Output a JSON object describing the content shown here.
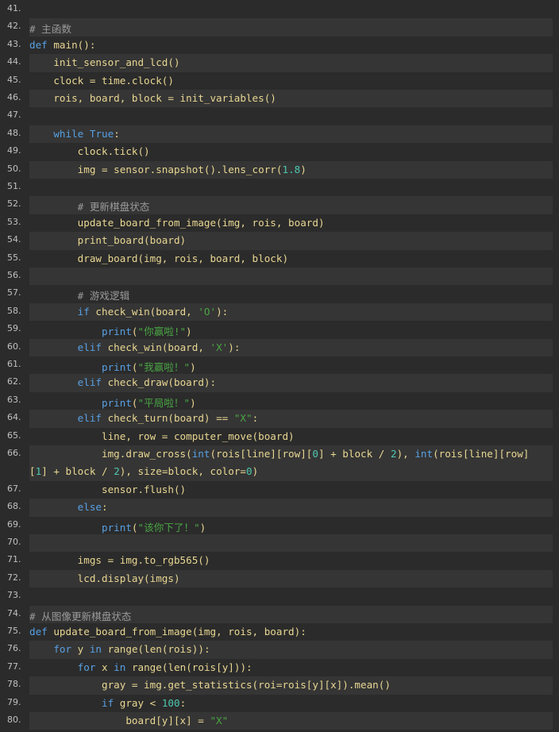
{
  "colors": {
    "background": "#2b2b2b",
    "alt_row": "#353535",
    "keyword": "#57a0e3",
    "function": "#e9d792",
    "string": "#4aa544",
    "number": "#4ec9b0",
    "comment": "#9a9a9a",
    "text": "#d0d0d0",
    "line_number": "#c0c0c0"
  },
  "lines": [
    {
      "num": "41.",
      "tokens": []
    },
    {
      "num": "42.",
      "tokens": [
        {
          "t": "# 主函数",
          "c": "comment"
        }
      ]
    },
    {
      "num": "43.",
      "tokens": [
        {
          "t": "def",
          "c": "kw"
        },
        {
          "t": " main():",
          "c": "fn"
        }
      ]
    },
    {
      "num": "44.",
      "tokens": [
        {
          "t": "    init_sensor_and_lcd()",
          "c": "fn"
        }
      ]
    },
    {
      "num": "45.",
      "tokens": [
        {
          "t": "    clock = time.clock()",
          "c": "fn"
        }
      ]
    },
    {
      "num": "46.",
      "tokens": [
        {
          "t": "    rois, board, block = init_variables()",
          "c": "fn"
        }
      ]
    },
    {
      "num": "47.",
      "tokens": []
    },
    {
      "num": "48.",
      "tokens": [
        {
          "t": "    ",
          "c": "default"
        },
        {
          "t": "while",
          "c": "kw"
        },
        {
          "t": " ",
          "c": "default"
        },
        {
          "t": "True",
          "c": "kw"
        },
        {
          "t": ":",
          "c": "fn"
        }
      ]
    },
    {
      "num": "49.",
      "tokens": [
        {
          "t": "        clock.tick()",
          "c": "fn"
        }
      ]
    },
    {
      "num": "50.",
      "tokens": [
        {
          "t": "        img = sensor.snapshot().lens_corr(",
          "c": "fn"
        },
        {
          "t": "1.8",
          "c": "num"
        },
        {
          "t": ")",
          "c": "fn"
        }
      ]
    },
    {
      "num": "51.",
      "tokens": []
    },
    {
      "num": "52.",
      "tokens": [
        {
          "t": "        # 更新棋盘状态",
          "c": "comment"
        }
      ]
    },
    {
      "num": "53.",
      "tokens": [
        {
          "t": "        update_board_from_image(img, rois, board)",
          "c": "fn"
        }
      ]
    },
    {
      "num": "54.",
      "tokens": [
        {
          "t": "        print_board(board)",
          "c": "fn"
        }
      ]
    },
    {
      "num": "55.",
      "tokens": [
        {
          "t": "        draw_board(img, rois, board, block)",
          "c": "fn"
        }
      ]
    },
    {
      "num": "56.",
      "tokens": []
    },
    {
      "num": "57.",
      "tokens": [
        {
          "t": "        # 游戏逻辑",
          "c": "comment"
        }
      ]
    },
    {
      "num": "58.",
      "tokens": [
        {
          "t": "        ",
          "c": "default"
        },
        {
          "t": "if",
          "c": "kw"
        },
        {
          "t": " check_win(board, ",
          "c": "fn"
        },
        {
          "t": "'O'",
          "c": "str"
        },
        {
          "t": "):",
          "c": "fn"
        }
      ]
    },
    {
      "num": "59.",
      "tokens": [
        {
          "t": "            ",
          "c": "default"
        },
        {
          "t": "print",
          "c": "kw"
        },
        {
          "t": "(",
          "c": "fn"
        },
        {
          "t": "\"你赢啦!\"",
          "c": "str"
        },
        {
          "t": ")",
          "c": "fn"
        }
      ]
    },
    {
      "num": "60.",
      "tokens": [
        {
          "t": "        ",
          "c": "default"
        },
        {
          "t": "elif",
          "c": "kw"
        },
        {
          "t": " check_win(board, ",
          "c": "fn"
        },
        {
          "t": "'X'",
          "c": "str"
        },
        {
          "t": "):",
          "c": "fn"
        }
      ]
    },
    {
      "num": "61.",
      "tokens": [
        {
          "t": "            ",
          "c": "default"
        },
        {
          "t": "print",
          "c": "kw"
        },
        {
          "t": "(",
          "c": "fn"
        },
        {
          "t": "\"我赢啦！\"",
          "c": "str"
        },
        {
          "t": ")",
          "c": "fn"
        }
      ]
    },
    {
      "num": "62.",
      "tokens": [
        {
          "t": "        ",
          "c": "default"
        },
        {
          "t": "elif",
          "c": "kw"
        },
        {
          "t": " check_draw(board):",
          "c": "fn"
        }
      ]
    },
    {
      "num": "63.",
      "tokens": [
        {
          "t": "            ",
          "c": "default"
        },
        {
          "t": "print",
          "c": "kw"
        },
        {
          "t": "(",
          "c": "fn"
        },
        {
          "t": "\"平局啦！\"",
          "c": "str"
        },
        {
          "t": ")",
          "c": "fn"
        }
      ]
    },
    {
      "num": "64.",
      "tokens": [
        {
          "t": "        ",
          "c": "default"
        },
        {
          "t": "elif",
          "c": "kw"
        },
        {
          "t": " check_turn(board) == ",
          "c": "fn"
        },
        {
          "t": "\"X\"",
          "c": "str"
        },
        {
          "t": ":",
          "c": "fn"
        }
      ]
    },
    {
      "num": "65.",
      "tokens": [
        {
          "t": "            line, row = computer_move(board)",
          "c": "fn"
        }
      ]
    },
    {
      "num": "66.",
      "wrap": true,
      "tokens": [
        {
          "t": "            img.draw_cross(",
          "c": "fn"
        },
        {
          "t": "int",
          "c": "kw"
        },
        {
          "t": "(rois[line][row][",
          "c": "fn"
        },
        {
          "t": "0",
          "c": "num"
        },
        {
          "t": "] + block / ",
          "c": "fn"
        },
        {
          "t": "2",
          "c": "num"
        },
        {
          "t": "), ",
          "c": "fn"
        },
        {
          "t": "int",
          "c": "kw"
        },
        {
          "t": "(rois[line][row]\n[",
          "c": "fn"
        },
        {
          "t": "1",
          "c": "num"
        },
        {
          "t": "] + block / ",
          "c": "fn"
        },
        {
          "t": "2",
          "c": "num"
        },
        {
          "t": "), size=block, color=",
          "c": "fn"
        },
        {
          "t": "0",
          "c": "num"
        },
        {
          "t": ")",
          "c": "fn"
        }
      ]
    },
    {
      "num": "67.",
      "tokens": [
        {
          "t": "            sensor.flush()",
          "c": "fn"
        }
      ]
    },
    {
      "num": "68.",
      "tokens": [
        {
          "t": "        ",
          "c": "default"
        },
        {
          "t": "else",
          "c": "kw"
        },
        {
          "t": ":",
          "c": "fn"
        }
      ]
    },
    {
      "num": "69.",
      "tokens": [
        {
          "t": "            ",
          "c": "default"
        },
        {
          "t": "print",
          "c": "kw"
        },
        {
          "t": "(",
          "c": "fn"
        },
        {
          "t": "\"该你下了！\"",
          "c": "str"
        },
        {
          "t": ")",
          "c": "fn"
        }
      ]
    },
    {
      "num": "70.",
      "tokens": []
    },
    {
      "num": "71.",
      "tokens": [
        {
          "t": "        imgs = img.to_rgb565()",
          "c": "fn"
        }
      ]
    },
    {
      "num": "72.",
      "tokens": [
        {
          "t": "        lcd.display(imgs)",
          "c": "fn"
        }
      ]
    },
    {
      "num": "73.",
      "tokens": []
    },
    {
      "num": "74.",
      "tokens": [
        {
          "t": "# 从图像更新棋盘状态",
          "c": "comment"
        }
      ]
    },
    {
      "num": "75.",
      "tokens": [
        {
          "t": "def",
          "c": "kw"
        },
        {
          "t": " update_board_from_image(img, rois, board):",
          "c": "fn"
        }
      ]
    },
    {
      "num": "76.",
      "tokens": [
        {
          "t": "    ",
          "c": "default"
        },
        {
          "t": "for",
          "c": "kw"
        },
        {
          "t": " y ",
          "c": "fn"
        },
        {
          "t": "in",
          "c": "kw"
        },
        {
          "t": " ",
          "c": "fn"
        },
        {
          "t": "range",
          "c": "fn"
        },
        {
          "t": "(",
          "c": "fn"
        },
        {
          "t": "len",
          "c": "fn"
        },
        {
          "t": "(rois)):",
          "c": "fn"
        }
      ]
    },
    {
      "num": "77.",
      "tokens": [
        {
          "t": "        ",
          "c": "default"
        },
        {
          "t": "for",
          "c": "kw"
        },
        {
          "t": " x ",
          "c": "fn"
        },
        {
          "t": "in",
          "c": "kw"
        },
        {
          "t": " ",
          "c": "fn"
        },
        {
          "t": "range",
          "c": "fn"
        },
        {
          "t": "(",
          "c": "fn"
        },
        {
          "t": "len",
          "c": "fn"
        },
        {
          "t": "(rois[y])):",
          "c": "fn"
        }
      ]
    },
    {
      "num": "78.",
      "tokens": [
        {
          "t": "            gray = img.get_statistics(roi=rois[y][x]).mean()",
          "c": "fn"
        }
      ]
    },
    {
      "num": "79.",
      "tokens": [
        {
          "t": "            ",
          "c": "default"
        },
        {
          "t": "if",
          "c": "kw"
        },
        {
          "t": " gray < ",
          "c": "fn"
        },
        {
          "t": "100",
          "c": "num"
        },
        {
          "t": ":",
          "c": "fn"
        }
      ]
    },
    {
      "num": "80.",
      "tokens": [
        {
          "t": "                board[y][x] = ",
          "c": "fn"
        },
        {
          "t": "\"X\"",
          "c": "str"
        }
      ]
    }
  ]
}
